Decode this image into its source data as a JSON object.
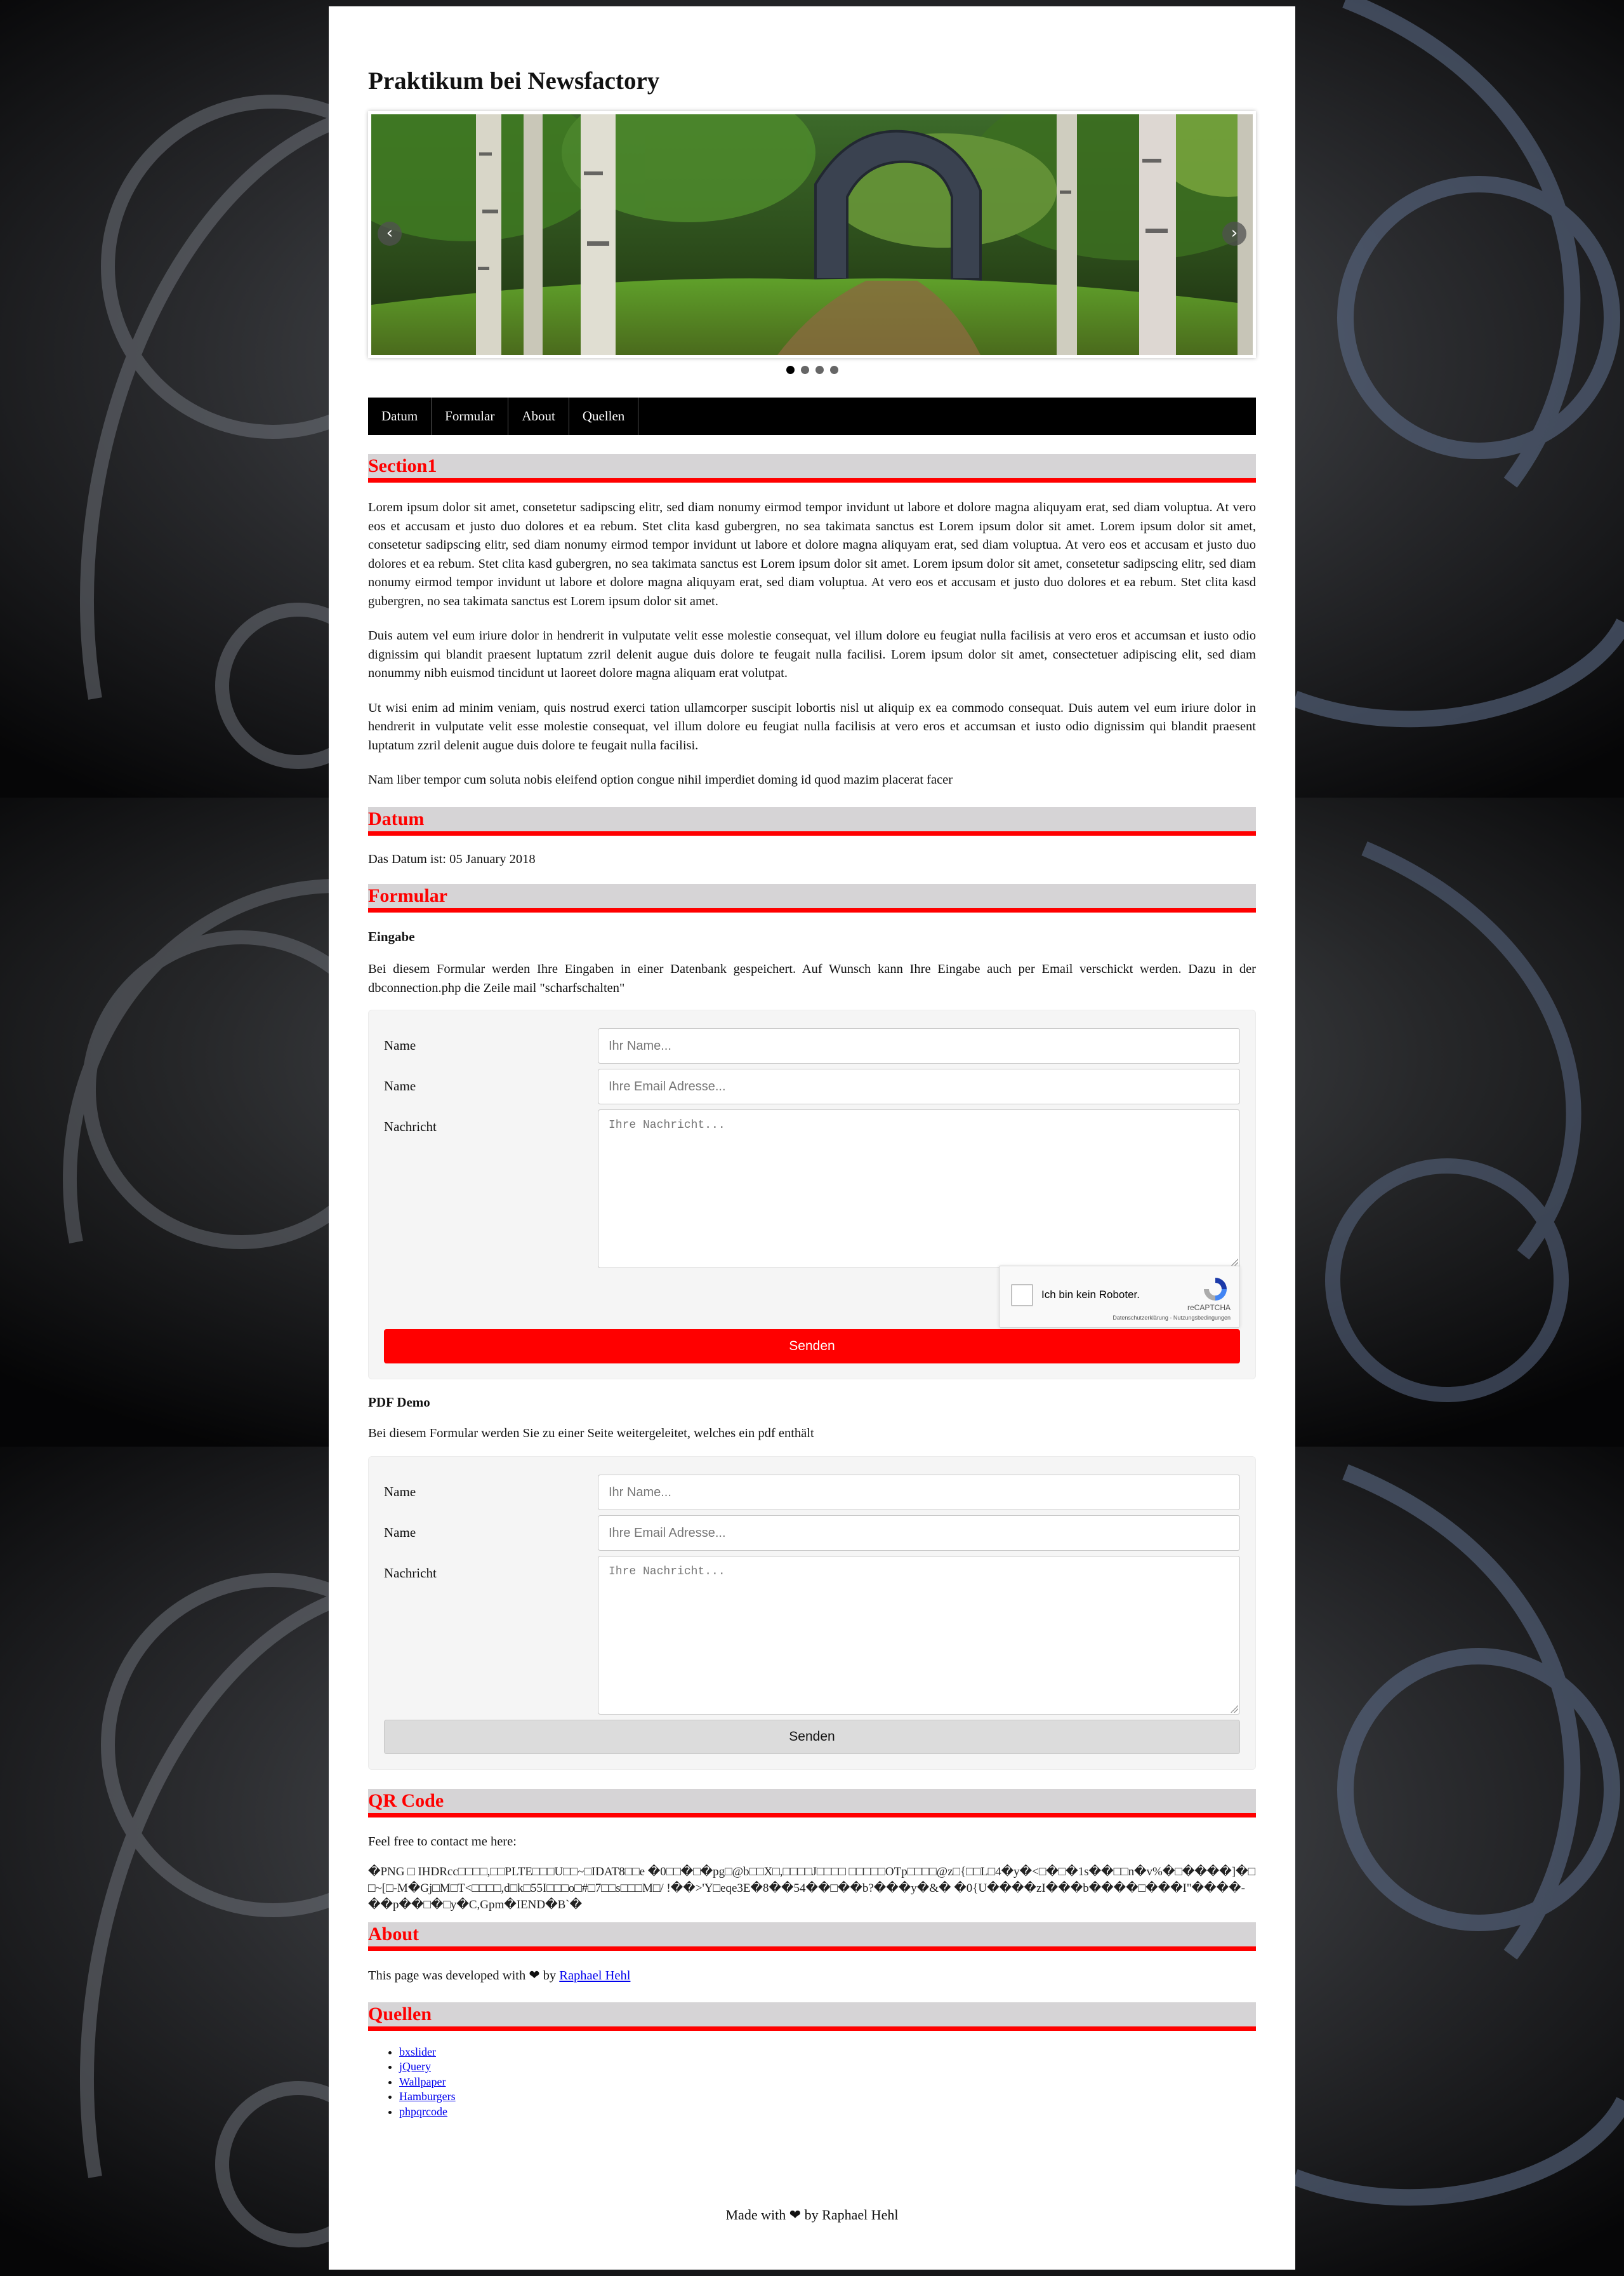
{
  "site": {
    "title": "Praktikum bei Newsfactory"
  },
  "slider": {
    "prev": "‹",
    "next": "›",
    "pages": 4,
    "active_page": 1,
    "icon_prev": "chevron-left-icon",
    "icon_next": "chevron-right-icon"
  },
  "nav": {
    "items": [
      "Datum",
      "Formular",
      "About",
      "Quellen"
    ]
  },
  "section1": {
    "heading": "Section1",
    "paragraphs": [
      "Lorem ipsum dolor sit amet, consetetur sadipscing elitr, sed diam nonumy eirmod tempor invidunt ut labore et dolore magna aliquyam erat, sed diam voluptua. At vero eos et accusam et justo duo dolores et ea rebum. Stet clita kasd gubergren, no sea takimata sanctus est Lorem ipsum dolor sit amet. Lorem ipsum dolor sit amet, consetetur sadipscing elitr, sed diam nonumy eirmod tempor invidunt ut labore et dolore magna aliquyam erat, sed diam voluptua. At vero eos et accusam et justo duo dolores et ea rebum. Stet clita kasd gubergren, no sea takimata sanctus est Lorem ipsum dolor sit amet. Lorem ipsum dolor sit amet, consetetur sadipscing elitr, sed diam nonumy eirmod tempor invidunt ut labore et dolore magna aliquyam erat, sed diam voluptua. At vero eos et accusam et justo duo dolores et ea rebum. Stet clita kasd gubergren, no sea takimata sanctus est Lorem ipsum dolor sit amet.",
      "Duis autem vel eum iriure dolor in hendrerit in vulputate velit esse molestie consequat, vel illum dolore eu feugiat nulla facilisis at vero eros et accumsan et iusto odio dignissim qui blandit praesent luptatum zzril delenit augue duis dolore te feugait nulla facilisi. Lorem ipsum dolor sit amet, consectetuer adipiscing elit, sed diam nonummy nibh euismod tincidunt ut laoreet dolore magna aliquam erat volutpat.",
      "Ut wisi enim ad minim veniam, quis nostrud exerci tation ullamcorper suscipit lobortis nisl ut aliquip ex ea commodo consequat. Duis autem vel eum iriure dolor in hendrerit in vulputate velit esse molestie consequat, vel illum dolore eu feugiat nulla facilisis at vero eros et accumsan et iusto odio dignissim qui blandit praesent luptatum zzril delenit augue duis dolore te feugait nulla facilisi.",
      "Nam liber tempor cum soluta nobis eleifend option congue nihil imperdiet doming id quod mazim placerat facer"
    ]
  },
  "datum": {
    "heading": "Datum",
    "text": "Das Datum ist: 05 January 2018"
  },
  "formular": {
    "heading": "Formular",
    "eingabe": {
      "title": "Eingabe",
      "description": "Bei diesem Formular werden Ihre Eingaben in einer Datenbank gespeichert. Auf Wunsch kann Ihre Eingabe auch per Email verschickt werden. Dazu in der dbconnection.php die Zeile mail \"scharfschalten\"",
      "label_name": "Name",
      "label_email": "Name",
      "label_message": "Nachricht",
      "placeholder_name": "Ihr Name...",
      "placeholder_email": "Ihre Email Adresse...",
      "placeholder_message": "Ihre Nachricht...",
      "captcha_label": "Ich bin kein Roboter.",
      "captcha_brand": "reCAPTCHA",
      "captcha_links": "Datenschutzerklärung - Nutzungsbedingungen",
      "captcha_icon": "recaptcha-icon",
      "submit": "Senden",
      "submit_color": "#ff0000"
    },
    "pdf": {
      "title": "PDF Demo",
      "description": "Bei diesem Formular werden Sie zu einer Seite weitergeleitet, welches ein pdf enthält",
      "label_name": "Name",
      "label_email": "Name",
      "label_message": "Nachricht",
      "placeholder_name": "Ihr Name...",
      "placeholder_email": "Ihre Email Adresse...",
      "placeholder_message": "Ihre Nachricht...",
      "submit": "Senden"
    }
  },
  "qr": {
    "heading": "QR Code",
    "intro": "Feel free to contact me here:",
    "binary": "�PNG □ IHDRcc□□□□,□□PLTE□□□U□□~□IDAT8□□e �0□□�□�pg□@b□□X□,□□□□J□□□□ □□□□□OTp□□□□@z□{□□L□4�y�<□�□�1s��□□n�v%�□����]�□□~[□-M�Gj□M□T<□□□□,d□k□55I□□□o□#□7□□s□□□M□/ !��>'Y□eqe3E�8��54��□��b?���y�&� �0{U����zI���b����□���I\"����-��p��□�□y�C,Gpm�IEND�B`�"
  },
  "about": {
    "heading": "About",
    "text_before": "This page was developed with",
    "heart": "❤",
    "text_by": "by",
    "author_link": "Raphael Hehl",
    "icon": "heart-icon"
  },
  "quellen": {
    "heading": "Quellen",
    "links": [
      "bxslider",
      "jQuery",
      "Wallpaper",
      "Hamburgers",
      "phpqrcode"
    ]
  },
  "footer": {
    "text_before": "Made with",
    "heart": "❤",
    "text_after": "by Raphael Hehl",
    "icon": "heart-icon"
  },
  "colors": {
    "accent": "#ff0000",
    "section_bg": "#d6d4d6",
    "nav_bg": "#000000"
  }
}
